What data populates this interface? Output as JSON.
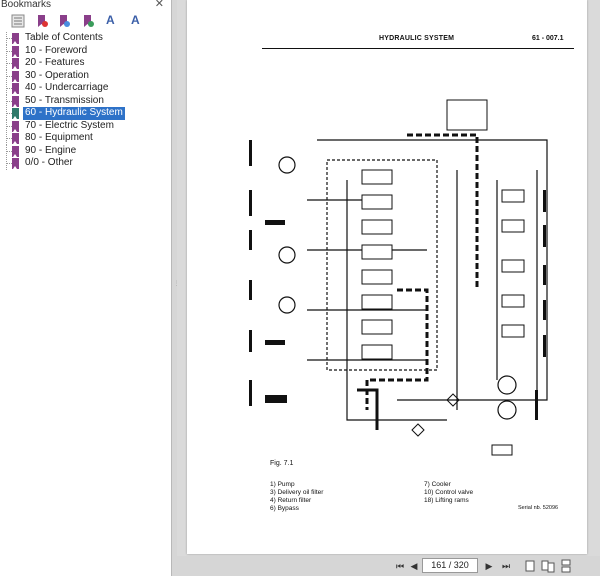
{
  "panel": {
    "title": "Bookmarks",
    "close_label": "✕",
    "toolbar_text": [
      "A",
      "A"
    ]
  },
  "bookmarks": [
    {
      "label": "Table of Contents",
      "active": false
    },
    {
      "label": "10 - Foreword",
      "active": false
    },
    {
      "label": "20 - Features",
      "active": false
    },
    {
      "label": "30 - Operation",
      "active": false
    },
    {
      "label": "40 - Undercarriage",
      "active": false
    },
    {
      "label": "50 - Transmission",
      "active": false
    },
    {
      "label": "60 - Hydraulic System",
      "active": true
    },
    {
      "label": "70 - Electric System",
      "active": false
    },
    {
      "label": "80 - Equipment",
      "active": false
    },
    {
      "label": "90 - Engine",
      "active": false
    },
    {
      "label": "0/0 - Other",
      "active": false
    }
  ],
  "document": {
    "header_title": "HYDRAULIC SYSTEM",
    "header_number": "61 - 007.1",
    "figure_label": "Fig. 7.1",
    "legend_left": [
      "1) Pump",
      "3) Delivery oil filter",
      "4) Return filter",
      "6) Bypass"
    ],
    "legend_right": [
      "7) Cooler",
      "10) Control valve",
      "18) Lifting rams"
    ],
    "serial": "Serial nb. 52096"
  },
  "navigation": {
    "page_indicator": "161 / 320"
  },
  "colors": {
    "active_bookmark": "#2e72c8",
    "bookmark_icon": "#8a3f8a"
  }
}
